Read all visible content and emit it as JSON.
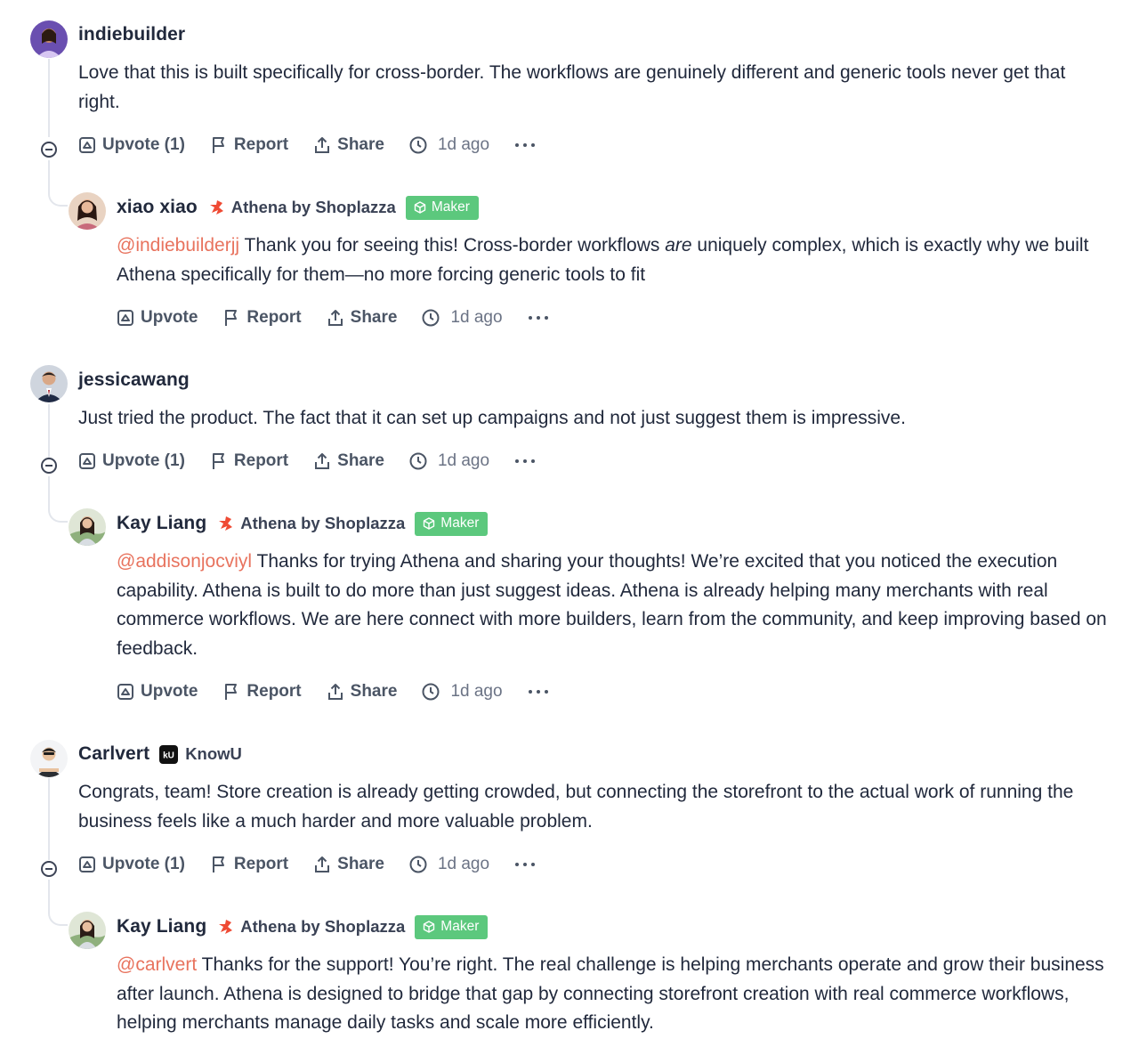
{
  "colors": {
    "mention": "#e8735e",
    "maker_badge": "#5cc87d",
    "text": "#21293c",
    "action": "#4b5565",
    "thread_line": "#e3e6ec"
  },
  "icons": {
    "upvote": "upvote-icon",
    "report": "flag-icon",
    "share": "share-icon",
    "time": "clock-icon",
    "more": "more-icon",
    "collapse": "collapse-icon",
    "maker": "cube-icon",
    "product": "athena-logo-icon"
  },
  "comments": [
    {
      "username": "indiebuilder",
      "body": "Love that this is built specifically for cross-border. The workflows are genuinely different and generic tools never get that right.",
      "actions": {
        "upvote": "Upvote (1)",
        "report": "Report",
        "share": "Share",
        "time": "1d ago"
      },
      "reply": {
        "username": "xiao xiao",
        "product": "Athena by Shoplazza",
        "badge": "Maker",
        "mention": "@indiebuilderjj",
        "text_before": " Thank you for seeing this! Cross-border workflows ",
        "text_em": "are",
        "text_after": " uniquely complex, which is exactly why we built Athena specifically for them—no more forcing generic tools to fit",
        "actions": {
          "upvote": "Upvote",
          "report": "Report",
          "share": "Share",
          "time": "1d ago"
        }
      }
    },
    {
      "username": "jessicawang",
      "body": "Just tried the product. The fact that it can set up campaigns and not just suggest them is impressive.",
      "actions": {
        "upvote": "Upvote (1)",
        "report": "Report",
        "share": "Share",
        "time": "1d ago"
      },
      "reply": {
        "username": "Kay Liang",
        "product": "Athena by Shoplazza",
        "badge": "Maker",
        "mention": "@addisonjocviyl",
        "text": " Thanks for trying Athena and sharing your thoughts! We’re excited that you noticed the execution capability. Athena is built to do more than just suggest ideas. Athena is already helping many merchants with real commerce workflows. We are here connect with more builders, learn from the community, and keep improving based on feedback.",
        "actions": {
          "upvote": "Upvote",
          "report": "Report",
          "share": "Share",
          "time": "1d ago"
        }
      }
    },
    {
      "username": "Carlvert",
      "product": "KnowU",
      "product_logo": "kU",
      "body": "Congrats, team! Store creation is already getting crowded, but connecting the storefront to the actual work of running the business feels like a much harder and more valuable problem.",
      "actions": {
        "upvote": "Upvote (1)",
        "report": "Report",
        "share": "Share",
        "time": "1d ago"
      },
      "reply": {
        "username": "Kay Liang",
        "product": "Athena by Shoplazza",
        "badge": "Maker",
        "mention": "@carlvert",
        "text": " Thanks for the support! You’re right. The real challenge is helping merchants operate and grow their business after launch. Athena is designed to bridge that gap by connecting storefront creation with real commerce workflows, helping merchants manage daily tasks and scale more efficiently."
      }
    }
  ]
}
